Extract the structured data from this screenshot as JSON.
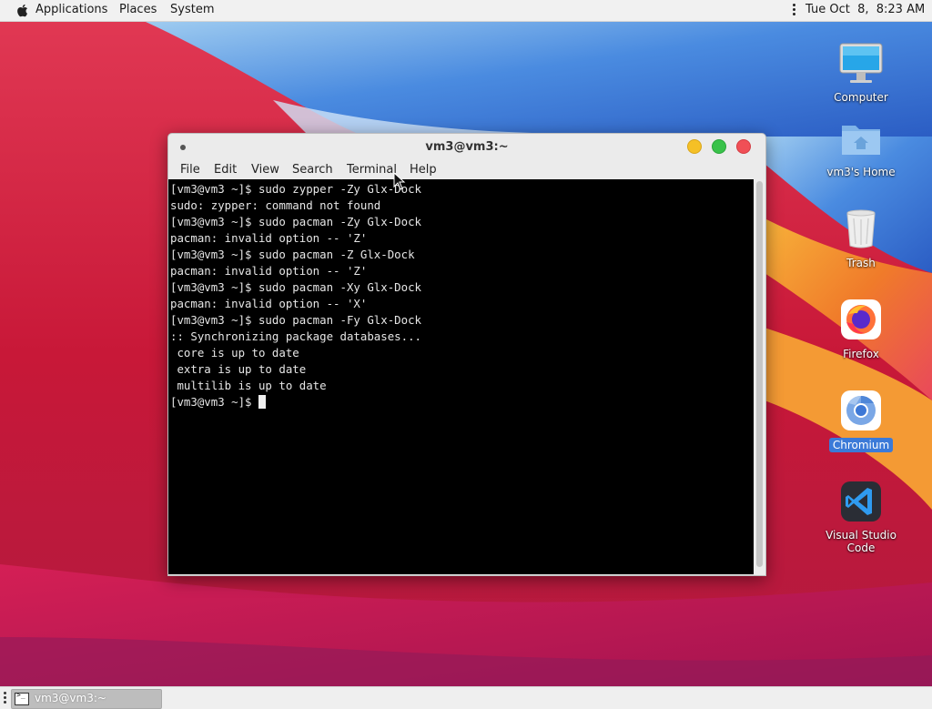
{
  "top_panel": {
    "menus": [
      "Applications",
      "Places",
      "System"
    ],
    "clock": "Tue Oct  8,  8:23 AM"
  },
  "desktop_icons": [
    {
      "label": "Computer",
      "icon": "computer-icon"
    },
    {
      "label": "vm3's Home",
      "icon": "home-folder-icon"
    },
    {
      "label": "Trash",
      "icon": "trash-icon"
    },
    {
      "label": "Firefox",
      "icon": "firefox-icon"
    },
    {
      "label": "Chromium",
      "icon": "chromium-icon",
      "selected": true
    },
    {
      "label": "Visual Studio Code",
      "icon": "vscode-icon"
    }
  ],
  "terminal": {
    "title": "vm3@vm3:~",
    "menu": [
      "File",
      "Edit",
      "View",
      "Search",
      "Terminal",
      "Help"
    ],
    "lines": [
      "[vm3@vm3 ~]$ sudo zypper -Zy Glx-Dock",
      "sudo: zypper: command not found",
      "[vm3@vm3 ~]$ sudo pacman -Zy Glx-Dock",
      "pacman: invalid option -- 'Z'",
      "[vm3@vm3 ~]$ sudo pacman -Z Glx-Dock",
      "pacman: invalid option -- 'Z'",
      "[vm3@vm3 ~]$ sudo pacman -Xy Glx-Dock",
      "pacman: invalid option -- 'X'",
      "[vm3@vm3 ~]$ sudo pacman -Fy Glx-Dock",
      ":: Synchronizing package databases...",
      " core is up to date",
      " extra is up to date",
      " multilib is up to date"
    ],
    "prompt": "[vm3@vm3 ~]$ "
  },
  "taskbar": {
    "items": [
      {
        "label": "vm3@vm3:~",
        "icon": "terminal-icon"
      }
    ]
  },
  "colors": {
    "wallpaper_red": "#d7223f",
    "wallpaper_blue": "#2f6fd0",
    "wallpaper_orange": "#f28a2c",
    "selection_blue": "#3b7ad8",
    "terminal_bg": "#000000"
  }
}
